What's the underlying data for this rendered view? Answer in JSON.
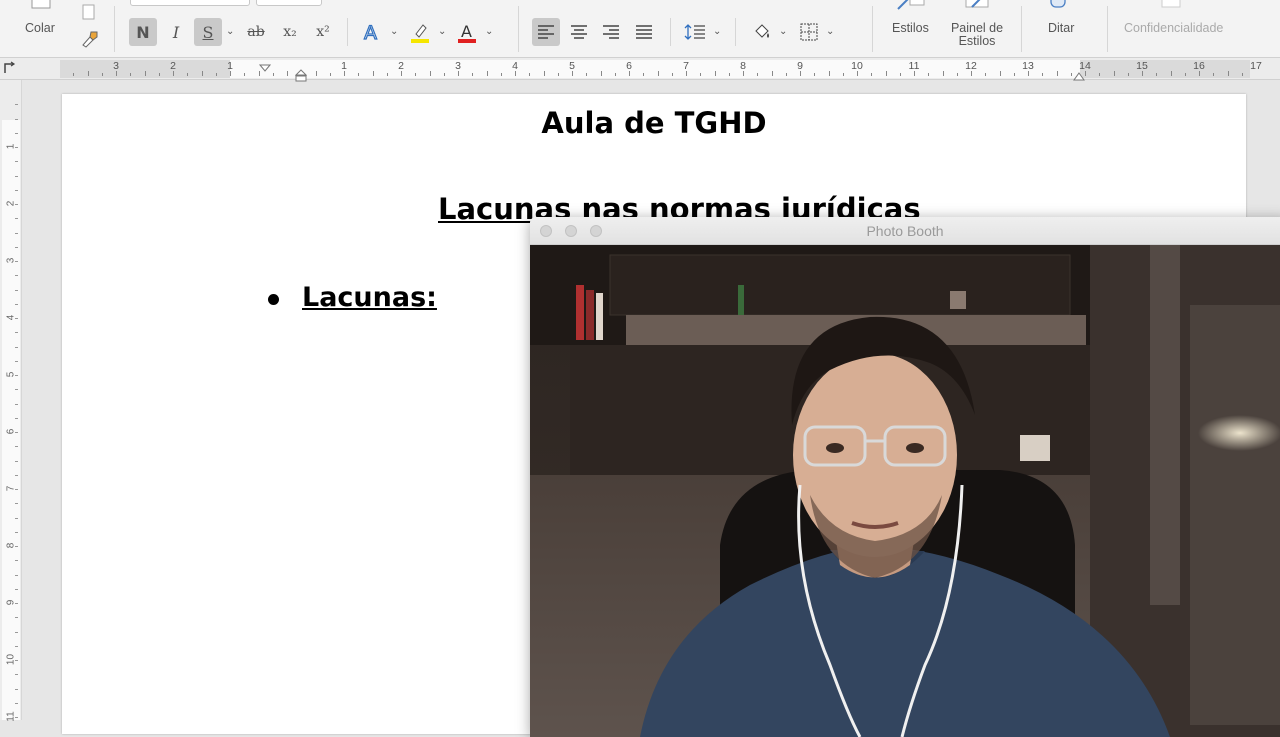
{
  "ribbon": {
    "paste_label": "Colar",
    "bold_label": "N",
    "italic_label": "I",
    "underline_label": "S",
    "strikethrough_label": "ab",
    "subscript_label": "x₂",
    "superscript_label": "x²",
    "styles_label": "Estilos",
    "styles_pane_label_line1": "Painel de",
    "styles_pane_label_line2": "Estilos",
    "dictate_label": "Ditar",
    "sensitivity_label": "Confidencialidade",
    "highlight_color": "#f5e600",
    "font_color": "#e02020",
    "text_effects_color": "#2f6fbf"
  },
  "ruler": {
    "numbers_left": [
      "3",
      "2",
      "1"
    ],
    "numbers_right": [
      "1",
      "2",
      "3",
      "4",
      "5",
      "6",
      "7",
      "8",
      "9",
      "10",
      "11",
      "12",
      "13",
      "14",
      "15",
      "16",
      "17"
    ],
    "vertical_numbers": [
      "1",
      "2",
      "3",
      "4",
      "5",
      "6",
      "7",
      "8",
      "9",
      "10",
      "11"
    ]
  },
  "document": {
    "title": "Aula de TGHD",
    "subtitle": "Lacunas nas normas jurídicas",
    "bullet_item": "Lacunas:"
  },
  "photobooth": {
    "window_title": "Photo Booth"
  }
}
